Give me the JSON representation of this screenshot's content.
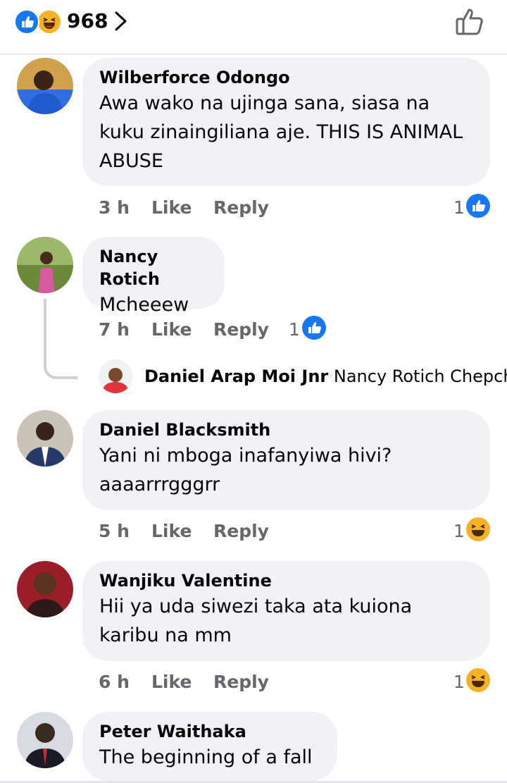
{
  "header": {
    "reaction_count": "968",
    "reactions": [
      "like-icon",
      "haha-icon"
    ]
  },
  "colors": {
    "like_blue": "#1877f2",
    "haha_yellow": "#f7b125",
    "bubble_bg": "#f0f2f5",
    "meta_gray": "#65676b"
  },
  "comments": [
    {
      "author": "Wilberforce Odongo",
      "text": "Awa wako na ujinga sana, siasa na kuku zinaingiliana aje. THIS IS ANIMAL ABUSE",
      "time": "3 h",
      "like": "Like",
      "reply": "Reply",
      "reaction_count": "1",
      "reaction": "like-icon"
    },
    {
      "author": "Nancy Rotich",
      "text": "Mcheeew",
      "time": "7 h",
      "like": "Like",
      "reply": "Reply",
      "reaction_count": "1",
      "reaction": "like-icon",
      "reply_preview": {
        "author": "Daniel Arap Moi Jnr",
        "text": "Nancy Rotich Chepch..."
      }
    },
    {
      "author": "Daniel Blacksmith",
      "text": "Yani ni mboga inafanyiwa hivi? aaaarrrgggrr",
      "time": "5 h",
      "like": "Like",
      "reply": "Reply",
      "reaction_count": "1",
      "reaction": "haha-icon"
    },
    {
      "author": "Wanjiku Valentine",
      "text": "Hii ya uda siwezi taka ata kuiona karibu na mm",
      "time": "6 h",
      "like": "Like",
      "reply": "Reply",
      "reaction_count": "1",
      "reaction": "haha-icon"
    },
    {
      "author": "Peter Waithaka",
      "text": "The beginning of a fall"
    }
  ]
}
